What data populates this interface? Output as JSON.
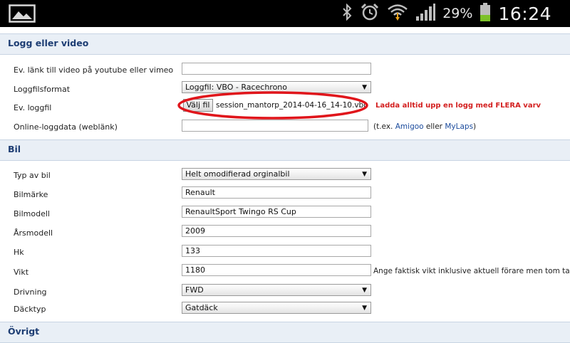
{
  "status_bar": {
    "battery_percent": "29%",
    "time": "16:24",
    "icons": [
      "gallery-icon",
      "bluetooth-icon",
      "alarm-icon",
      "wifi-icon",
      "signal-icon",
      "battery-icon"
    ]
  },
  "sections": {
    "logg": {
      "title": "Logg eller video",
      "video_link": {
        "label": "Ev. länk till video på youtube eller vimeo",
        "value": ""
      },
      "log_format": {
        "label": "Loggfilsformat",
        "selected": "Loggfil: VBO - Racechrono"
      },
      "log_file": {
        "label": "Ev. loggfil",
        "button": "Välj fil",
        "filename": "session_mantorp_2014-04-16_14-10.vbo",
        "warning": "Ladda alltid upp en logg med FLERA varv"
      },
      "online_data": {
        "label": "Online-loggdata (weblänk)",
        "value": "",
        "hint_prefix": "(t.ex.",
        "link1": "Amigoo",
        "hint_mid": "eller",
        "link2": "MyLaps",
        "hint_suffix": ")"
      }
    },
    "bil": {
      "title": "Bil",
      "car_type": {
        "label": "Typ av bil",
        "selected": "Helt omodifierad orginalbil"
      },
      "brand": {
        "label": "Bilmärke",
        "value": "Renault"
      },
      "model": {
        "label": "Bilmodell",
        "value": "RenaultSport Twingo RS Cup"
      },
      "year": {
        "label": "Årsmodell",
        "value": "2009"
      },
      "hp": {
        "label": "Hk",
        "value": "133"
      },
      "weight": {
        "label": "Vikt",
        "value": "1180",
        "hint": "Ange faktisk vikt inklusive aktuell förare men tom tank"
      },
      "drive": {
        "label": "Drivning",
        "selected": "FWD"
      },
      "tires": {
        "label": "Däcktyp",
        "selected": "Gatdäck"
      }
    },
    "ovrigt": {
      "title": "Övrigt"
    }
  },
  "colors": {
    "header_bg": "#e9eff6",
    "header_text": "#1d3d73",
    "warning": "#d31f1f",
    "annotation": "#e0151b",
    "link": "#1a4a9c"
  }
}
